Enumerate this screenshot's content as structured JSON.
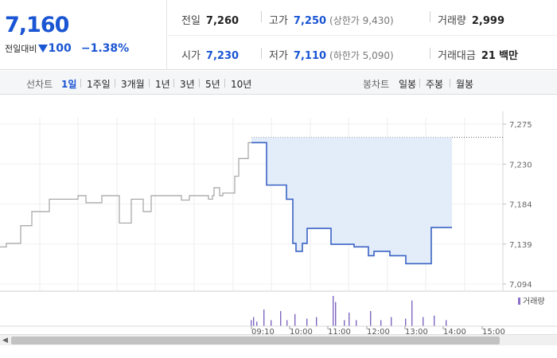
{
  "summary": {
    "current_price": "7,160",
    "change_label": "전일대비",
    "change_value": "100",
    "change_pct": "−1.38%",
    "prev_close_label": "전일",
    "prev_close": "7,260",
    "high_label": "고가",
    "high": "7,250",
    "upper_limit": "(상한가 9,430)",
    "volume_label": "거래량",
    "volume": "2,999",
    "open_label": "시가",
    "open": "7,230",
    "low_label": "저가",
    "low": "7,110",
    "lower_limit": "(하한가 5,090)",
    "value_label": "거래대금",
    "value": "21",
    "value_unit": "백만"
  },
  "period_bar": {
    "line_label": "선차트",
    "line_options": [
      "1일",
      "1주일",
      "3개월",
      "1년",
      "3년",
      "5년",
      "10년"
    ],
    "active": "1일",
    "candle_label": "봉차트",
    "candle_options": [
      "일봉",
      "주봉",
      "월봉"
    ]
  },
  "chart_data": {
    "type": "line",
    "y_ticks": [
      "7,275",
      "7,230",
      "7,184",
      "7,139",
      "7,094"
    ],
    "ylim": [
      7094,
      7275
    ],
    "volume_legend": "거래량",
    "series": [
      {
        "points": [
          [
            0,
            7136
          ],
          [
            8,
            7136
          ],
          [
            8,
            7140
          ],
          [
            26,
            7140
          ],
          [
            26,
            7160
          ],
          [
            40,
            7160
          ],
          [
            40,
            7176
          ],
          [
            62,
            7176
          ],
          [
            62,
            7190
          ],
          [
            98,
            7190
          ],
          [
            98,
            7194
          ],
          [
            108,
            7194
          ],
          [
            108,
            7186
          ],
          [
            128,
            7186
          ],
          [
            128,
            7194
          ],
          [
            150,
            7194
          ],
          [
            150,
            7163
          ],
          [
            165,
            7163
          ],
          [
            165,
            7190
          ],
          [
            180,
            7190
          ],
          [
            180,
            7176
          ],
          [
            190,
            7176
          ],
          [
            190,
            7194
          ],
          [
            228,
            7194
          ],
          [
            228,
            7189
          ],
          [
            238,
            7189
          ],
          [
            238,
            7194
          ],
          [
            262,
            7194
          ],
          [
            262,
            7190
          ],
          [
            267,
            7190
          ],
          [
            267,
            7194
          ],
          [
            269,
            7194
          ],
          [
            269,
            7203
          ],
          [
            276,
            7203
          ],
          [
            276,
            7194
          ],
          [
            280,
            7194
          ],
          [
            280,
            7197
          ],
          [
            295,
            7197
          ],
          [
            295,
            7216
          ],
          [
            300,
            7216
          ],
          [
            300,
            7236
          ],
          [
            312,
            7236
          ],
          [
            312,
            7254
          ],
          [
            316,
            7254
          ]
        ],
        "color": "#aaaaaa"
      },
      {
        "points": [
          [
            316,
            7254
          ],
          [
            335,
            7254
          ],
          [
            335,
            7206
          ],
          [
            360,
            7206
          ],
          [
            360,
            7190
          ],
          [
            368,
            7190
          ],
          [
            368,
            7140
          ],
          [
            372,
            7140
          ],
          [
            372,
            7131
          ],
          [
            380,
            7131
          ],
          [
            380,
            7140
          ],
          [
            386,
            7140
          ],
          [
            386,
            7157
          ],
          [
            416,
            7157
          ],
          [
            416,
            7139
          ],
          [
            445,
            7139
          ],
          [
            445,
            7136
          ],
          [
            463,
            7136
          ],
          [
            463,
            7126
          ],
          [
            470,
            7126
          ],
          [
            470,
            7131
          ],
          [
            490,
            7131
          ],
          [
            490,
            7126
          ],
          [
            510,
            7126
          ],
          [
            510,
            7117
          ],
          [
            542,
            7117
          ],
          [
            542,
            7158
          ],
          [
            568,
            7158
          ]
        ],
        "color": "#3a63c4"
      }
    ],
    "prev_close_value": 7260,
    "volume_bars": [
      [
        315,
        0.2
      ],
      [
        318,
        0.3
      ],
      [
        322,
        0.15
      ],
      [
        331,
        0.55
      ],
      [
        340,
        0.2
      ],
      [
        352,
        0.5
      ],
      [
        360,
        0.2
      ],
      [
        370,
        0.4
      ],
      [
        385,
        0.25
      ],
      [
        397,
        0.3
      ],
      [
        418,
        1.0
      ],
      [
        421,
        0.8
      ],
      [
        432,
        0.2
      ],
      [
        438,
        0.45
      ],
      [
        447,
        0.2
      ],
      [
        465,
        0.5
      ],
      [
        478,
        0.2
      ],
      [
        491,
        0.3
      ],
      [
        509,
        0.25
      ],
      [
        517,
        0.85
      ],
      [
        531,
        0.3
      ],
      [
        545,
        0.35
      ],
      [
        560,
        0.2
      ]
    ],
    "bottom_overlay": "",
    "x_labels": [
      "09:10",
      "10:00",
      "11:00",
      "12:00",
      "13:00",
      "14:00",
      "15:00"
    ]
  }
}
